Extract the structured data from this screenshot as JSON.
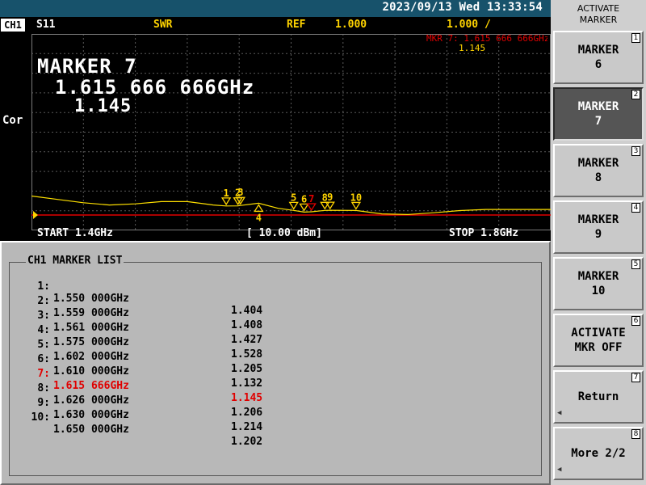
{
  "status_bar": {
    "datetime": "2023/09/13 Wed 13:33:54"
  },
  "header": {
    "channel": "CH1",
    "parameter": "S11",
    "format": "SWR",
    "ref_label": "REF",
    "ref_value": "1.000",
    "scale": "1.000 /"
  },
  "side_label": "Cor",
  "active_marker": {
    "title": "MARKER 7",
    "frequency": "1.615 666 666GHz",
    "value": "1.145",
    "readout_top": "MKR 7: 1.615 666 666GHz",
    "readout_value": "1.145"
  },
  "footer": {
    "start": "START 1.4GHz",
    "power": "[ 10.00 dBm]",
    "stop": "STOP 1.8GHz"
  },
  "marker_list": {
    "title": "CH1 MARKER LIST",
    "active_index": 6,
    "rows": [
      {
        "num": "1:",
        "freq": "1.550 000GHz",
        "value": "1.404"
      },
      {
        "num": "2:",
        "freq": "1.559 000GHz",
        "value": "1.408"
      },
      {
        "num": "3:",
        "freq": "1.561 000GHz",
        "value": "1.427"
      },
      {
        "num": "4:",
        "freq": "1.575 000GHz",
        "value": "1.528"
      },
      {
        "num": "5:",
        "freq": "1.602 000GHz",
        "value": "1.205"
      },
      {
        "num": "6:",
        "freq": "1.610 000GHz",
        "value": "1.132"
      },
      {
        "num": "7:",
        "freq": "1.615 666GHz",
        "value": "1.145"
      },
      {
        "num": "8:",
        "freq": "1.626 000GHz",
        "value": "1.206"
      },
      {
        "num": "9:",
        "freq": "1.630 000GHz",
        "value": "1.214"
      },
      {
        "num": "10:",
        "freq": "1.650 000GHz",
        "value": "1.202"
      }
    ]
  },
  "plot": {
    "trace_color": "#ffe000",
    "ref_line_color": "#e00000",
    "grid_color": "#5a5a5a",
    "marker_labels": [
      "1",
      "2",
      "3",
      "4",
      "5",
      "6",
      "7",
      "8",
      "9",
      "10"
    ],
    "marker_color": "#ffd400",
    "active_marker_color": "#e00000"
  },
  "softkeys": {
    "menu_title": "ACTIVATE\nMARKER",
    "items": [
      {
        "label": "MARKER\n6",
        "num": "1"
      },
      {
        "label": "MARKER\n7",
        "num": "2",
        "selected": true
      },
      {
        "label": "MARKER\n8",
        "num": "3"
      },
      {
        "label": "MARKER\n9",
        "num": "4"
      },
      {
        "label": "MARKER\n10",
        "num": "5"
      },
      {
        "label": "ACTIVATE\nMKR OFF",
        "num": "6"
      },
      {
        "label": "Return",
        "num": "7"
      },
      {
        "label": "More 2/2",
        "num": "8"
      }
    ]
  },
  "chart_data": {
    "type": "line",
    "title": "",
    "xlabel": "",
    "ylabel": "",
    "x_range_ghz": [
      1.4,
      1.8
    ],
    "ref_value": 1.0,
    "scale_per_div": 1.0,
    "series": [
      {
        "x": [
          1.4,
          1.42,
          1.44,
          1.46,
          1.48,
          1.5,
          1.52,
          1.54,
          1.55,
          1.559,
          1.561,
          1.575,
          1.59,
          1.602,
          1.61,
          1.615666,
          1.626,
          1.63,
          1.65,
          1.67,
          1.69,
          1.71,
          1.73,
          1.75,
          1.77,
          1.8
        ],
        "y": [
          1.85,
          1.7,
          1.55,
          1.45,
          1.5,
          1.6,
          1.6,
          1.45,
          1.404,
          1.408,
          1.427,
          1.528,
          1.3,
          1.205,
          1.132,
          1.145,
          1.206,
          1.214,
          1.202,
          1.05,
          1.02,
          1.1,
          1.2,
          1.25,
          1.25,
          1.25
        ]
      }
    ],
    "markers": [
      {
        "id": "1",
        "x": 1.55,
        "y": 1.404
      },
      {
        "id": "2",
        "x": 1.559,
        "y": 1.408
      },
      {
        "id": "3",
        "x": 1.561,
        "y": 1.427
      },
      {
        "id": "4",
        "x": 1.575,
        "y": 1.528
      },
      {
        "id": "5",
        "x": 1.602,
        "y": 1.205
      },
      {
        "id": "6",
        "x": 1.61,
        "y": 1.132
      },
      {
        "id": "7",
        "x": 1.615666,
        "y": 1.145
      },
      {
        "id": "8",
        "x": 1.626,
        "y": 1.206
      },
      {
        "id": "9",
        "x": 1.63,
        "y": 1.214
      },
      {
        "id": "10",
        "x": 1.65,
        "y": 1.202
      }
    ]
  }
}
